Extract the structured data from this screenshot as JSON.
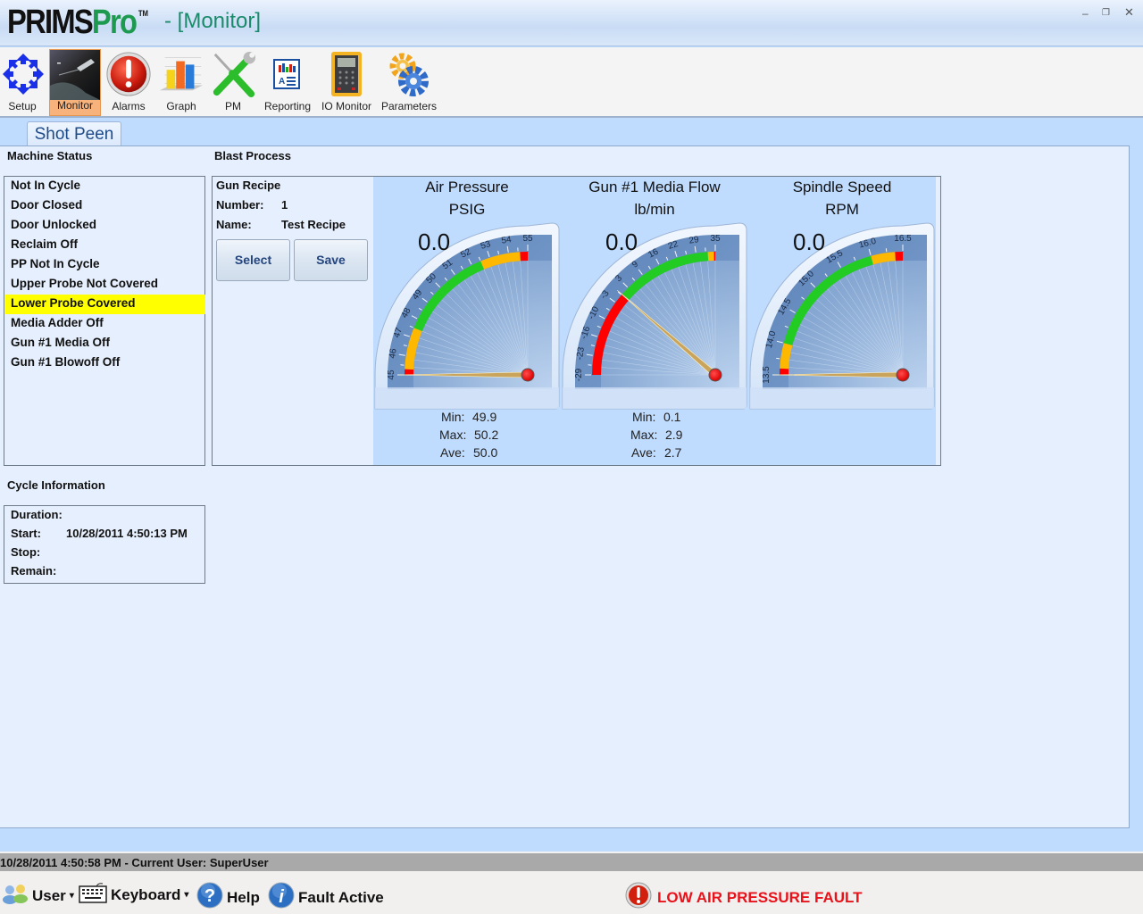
{
  "window": {
    "logo_main": "PRIMS",
    "logo_accent": "Pro",
    "logo_tm": "TM",
    "title": "- [Monitor]",
    "controls": [
      "minimize-icon",
      "restore-icon",
      "close-icon"
    ]
  },
  "toolbar": {
    "items": [
      {
        "label": "Setup",
        "icon": "setup-arrows-icon",
        "active": false
      },
      {
        "label": "Monitor",
        "icon": "monitor-photo-icon",
        "active": true
      },
      {
        "label": "Alarms",
        "icon": "alarm-exclamation-icon",
        "active": false
      },
      {
        "label": "Graph",
        "icon": "bar-graph-icon",
        "active": false
      },
      {
        "label": "PM",
        "icon": "wrench-screwdriver-icon",
        "active": false
      },
      {
        "label": "Reporting",
        "icon": "report-document-icon",
        "active": false
      },
      {
        "label": "IO Monitor",
        "icon": "multimeter-icon",
        "active": false
      },
      {
        "label": "Parameters",
        "icon": "gears-icon",
        "active": false
      }
    ]
  },
  "tabs": [
    {
      "label": "Shot Peen",
      "active": true
    }
  ],
  "machine_status": {
    "heading": "Machine Status",
    "items": [
      {
        "label": "Not In Cycle",
        "highlight": false
      },
      {
        "label": "Door Closed",
        "highlight": false
      },
      {
        "label": "Door Unlocked",
        "highlight": false
      },
      {
        "label": "Reclaim Off",
        "highlight": false
      },
      {
        "label": "PP Not In Cycle",
        "highlight": false
      },
      {
        "label": "Upper Probe Not Covered",
        "highlight": false
      },
      {
        "label": "Lower Probe Covered",
        "highlight": true
      },
      {
        "label": "Media Adder Off",
        "highlight": false
      },
      {
        "label": "Gun #1 Media Off",
        "highlight": false
      },
      {
        "label": "Gun #1 Blowoff Off",
        "highlight": false
      }
    ],
    "highlight_color": "#ffff00"
  },
  "cycle_info": {
    "heading": "Cycle Information",
    "rows": [
      {
        "label": "Duration:",
        "value": ""
      },
      {
        "label": "Start:",
        "value": "10/28/2011 4:50:13 PM"
      },
      {
        "label": "Stop:",
        "value": ""
      },
      {
        "label": "Remain:",
        "value": ""
      }
    ]
  },
  "blast_process": {
    "heading": "Blast Process",
    "recipe": {
      "title": "Gun Recipe",
      "number_label": "Number:",
      "number_value": "1",
      "name_label": "Name:",
      "name_value": "Test Recipe",
      "select_label": "Select",
      "save_label": "Save"
    },
    "gauges": [
      {
        "title": "Air Pressure",
        "unit": "PSIG",
        "readout": "0.0",
        "value": 0.0,
        "scale_min": 45,
        "scale_max": 55,
        "ticks": [
          "45",
          "46",
          "47",
          "48",
          "49",
          "50",
          "51",
          "52",
          "53",
          "54",
          "55"
        ],
        "bands": [
          {
            "from": 45,
            "to": 45.3,
            "color": "#ff0000"
          },
          {
            "from": 45.3,
            "to": 47.5,
            "color": "#ffb800"
          },
          {
            "from": 47.5,
            "to": 52.5,
            "color": "#22cc22"
          },
          {
            "from": 52.5,
            "to": 54.6,
            "color": "#ffb800"
          },
          {
            "from": 54.6,
            "to": 55,
            "color": "#ff0000"
          }
        ],
        "stats": {
          "min_label": "Min:",
          "min": "49.9",
          "max_label": "Max:",
          "max": "50.2",
          "ave_label": "Ave:",
          "ave": "50.0"
        }
      },
      {
        "title": "Gun #1 Media Flow",
        "unit": "lb/min",
        "readout": "0.0",
        "value": 0.0,
        "scale_min": -29,
        "scale_max": 35,
        "ticks": [
          "-29",
          "-23",
          "-16",
          "-10",
          "-3",
          "3",
          "9",
          "16",
          "22",
          "29",
          "35"
        ],
        "bands": [
          {
            "from": -29,
            "to": 0.2,
            "color": "#ff0000"
          },
          {
            "from": 0.2,
            "to": 32.5,
            "color": "#22cc22"
          },
          {
            "from": 32.5,
            "to": 34.6,
            "color": "#ffb800"
          },
          {
            "from": 34.6,
            "to": 35,
            "color": "#ff0000"
          }
        ],
        "stats": {
          "min_label": "Min:",
          "min": "0.1",
          "max_label": "Max:",
          "max": "2.9",
          "ave_label": "Ave:",
          "ave": "2.7"
        }
      },
      {
        "title": "Spindle Speed",
        "unit": "RPM",
        "readout": "0.0",
        "value": 0.0,
        "scale_min": 13.5,
        "scale_max": 16.5,
        "ticks": [
          "13.5",
          "14.0",
          "14.5",
          "15.0",
          "15.5",
          "16.0",
          "16.5"
        ],
        "bands": [
          {
            "from": 13.5,
            "to": 13.6,
            "color": "#ff0000"
          },
          {
            "from": 13.6,
            "to": 14.0,
            "color": "#ffb800"
          },
          {
            "from": 14.0,
            "to": 16.0,
            "color": "#22cc22"
          },
          {
            "from": 16.0,
            "to": 16.38,
            "color": "#ffb800"
          },
          {
            "from": 16.38,
            "to": 16.5,
            "color": "#ff0000"
          }
        ],
        "stats": null
      }
    ]
  },
  "statusbar": {
    "text": "10/28/2011 4:50:58 PM - Current User:  SuperUser"
  },
  "bottombar": {
    "user_label": "User",
    "keyboard_label": "Keyboard",
    "help_label": "Help",
    "fault_label": "Fault Active",
    "alert_text": "LOW AIR PRESSURE FAULT",
    "alert_color": "#e8121b"
  }
}
